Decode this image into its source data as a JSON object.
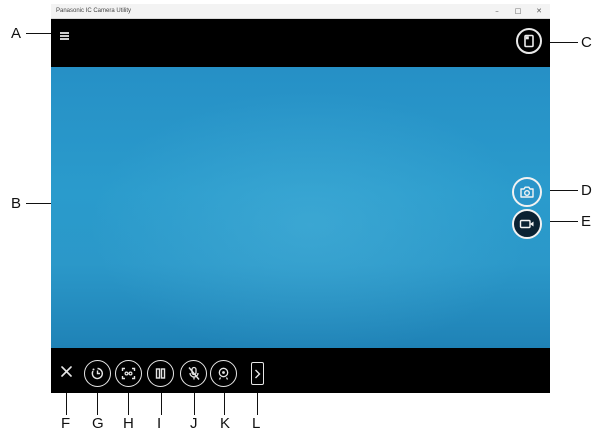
{
  "window": {
    "title": "Panasonic IC Camera Utility",
    "controls": {
      "minimize": "–",
      "maximize": "□",
      "close": "✕"
    }
  },
  "callouts": {
    "a": "A",
    "b": "B",
    "c": "C",
    "d": "D",
    "e": "E",
    "f": "F",
    "g": "G",
    "h": "H",
    "i": "I",
    "j": "J",
    "k": "K",
    "l": "L"
  },
  "icons": {
    "menu": "hamburger-menu-icon",
    "settings": "settings-panel-icon",
    "camera": "camera-icon",
    "video": "video-record-icon",
    "close": "close-icon",
    "timer": "self-timer-icon",
    "focus": "focus-frame-icon",
    "pause": "pause-icon",
    "mic": "microphone-muted-icon",
    "effects": "effects-icon",
    "expand": "chevron-right-icon"
  },
  "colors": {
    "viewfinder_blue": "#2a9bcc",
    "bar_black": "#000000",
    "icon_white": "#e9e9e9",
    "titlebar_gray": "#f3f3f3"
  }
}
